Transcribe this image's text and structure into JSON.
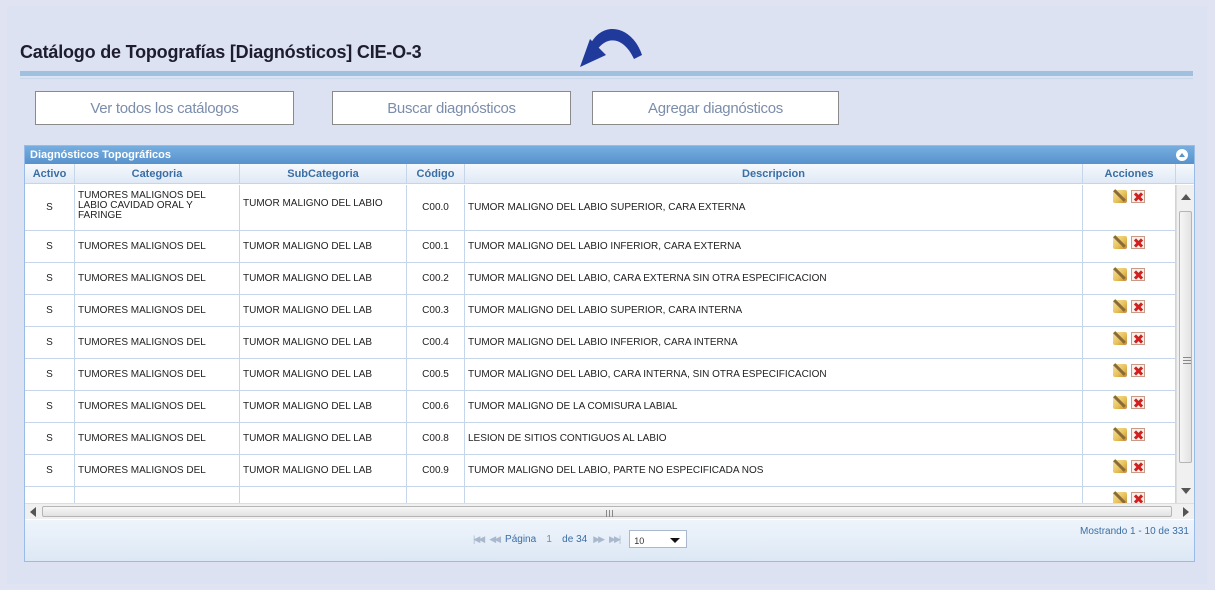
{
  "title": "Catálogo de Topografías [Diagnósticos] CIE-O-3",
  "buttons": {
    "ver_todos": "Ver todos los catálogos",
    "buscar": "Buscar diagnósticos",
    "agregar": "Agregar diagnósticos"
  },
  "grid": {
    "caption": "Diagnósticos Topográficos",
    "columns": [
      "Activo",
      "Categoria",
      "SubCategoria",
      "Código",
      "Descripcion",
      "Acciones"
    ],
    "rows": [
      {
        "activo": "S",
        "categoria": "TUMORES MALIGNOS DEL LABIO CAVIDAD ORAL Y FARINGE",
        "subcategoria": "TUMOR MALIGNO DEL LABIO",
        "codigo": "C00.0",
        "descripcion": "TUMOR MALIGNO DEL LABIO SUPERIOR, CARA EXTERNA"
      },
      {
        "activo": "S",
        "categoria": "TUMORES MALIGNOS DEL",
        "subcategoria": "TUMOR MALIGNO DEL LAB",
        "codigo": "C00.1",
        "descripcion": "TUMOR MALIGNO DEL LABIO INFERIOR, CARA EXTERNA"
      },
      {
        "activo": "S",
        "categoria": "TUMORES MALIGNOS DEL",
        "subcategoria": "TUMOR MALIGNO DEL LAB",
        "codigo": "C00.2",
        "descripcion": "TUMOR MALIGNO DEL LABIO, CARA EXTERNA SIN OTRA ESPECIFICACION"
      },
      {
        "activo": "S",
        "categoria": "TUMORES MALIGNOS DEL",
        "subcategoria": "TUMOR MALIGNO DEL LAB",
        "codigo": "C00.3",
        "descripcion": "TUMOR MALIGNO DEL LABIO SUPERIOR, CARA INTERNA"
      },
      {
        "activo": "S",
        "categoria": "TUMORES MALIGNOS DEL",
        "subcategoria": "TUMOR MALIGNO DEL LAB",
        "codigo": "C00.4",
        "descripcion": "TUMOR MALIGNO DEL LABIO INFERIOR, CARA INTERNA"
      },
      {
        "activo": "S",
        "categoria": "TUMORES MALIGNOS DEL",
        "subcategoria": "TUMOR MALIGNO DEL LAB",
        "codigo": "C00.5",
        "descripcion": "TUMOR MALIGNO DEL LABIO, CARA INTERNA, SIN OTRA ESPECIFICACION"
      },
      {
        "activo": "S",
        "categoria": "TUMORES MALIGNOS DEL",
        "subcategoria": "TUMOR MALIGNO DEL LAB",
        "codigo": "C00.6",
        "descripcion": "TUMOR MALIGNO DE LA COMISURA LABIAL"
      },
      {
        "activo": "S",
        "categoria": "TUMORES MALIGNOS DEL",
        "subcategoria": "TUMOR MALIGNO DEL LAB",
        "codigo": "C00.8",
        "descripcion": "LESION DE SITIOS CONTIGUOS AL LABIO"
      },
      {
        "activo": "S",
        "categoria": "TUMORES MALIGNOS DEL",
        "subcategoria": "TUMOR MALIGNO DEL LAB",
        "codigo": "C00.9",
        "descripcion": "TUMOR MALIGNO DEL LABIO, PARTE NO ESPECIFICADA NOS"
      }
    ]
  },
  "pager": {
    "first_icon": "first-page-icon",
    "prev_icon": "prev-page-icon",
    "next_icon": "next-page-icon",
    "last_icon": "last-page-icon",
    "page_label": "Página",
    "page_value": "1",
    "of_label": "de 34",
    "rows_per_page": "10",
    "summary": "Mostrando 1 - 10 de 331"
  },
  "colors": {
    "accent": "#1f3a9a",
    "header_text": "#3a6ea5",
    "rule": "#9fc1df"
  }
}
